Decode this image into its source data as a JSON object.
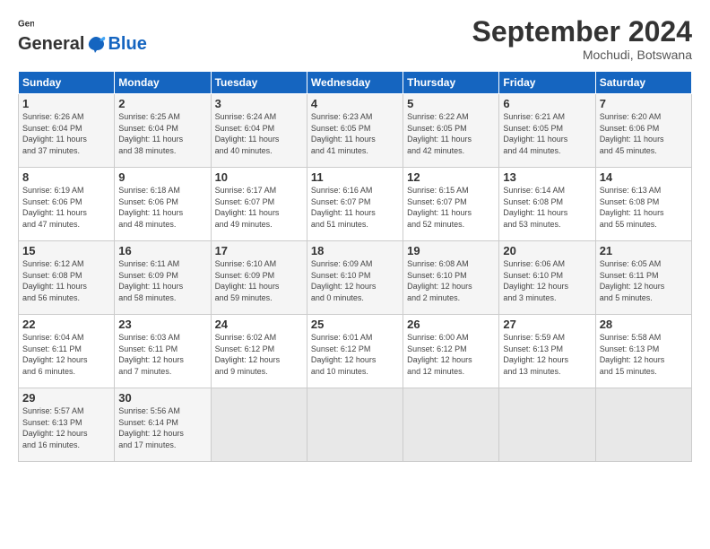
{
  "header": {
    "logo_general": "General",
    "logo_blue": "Blue",
    "month_title": "September 2024",
    "location": "Mochudi, Botswana"
  },
  "weekdays": [
    "Sunday",
    "Monday",
    "Tuesday",
    "Wednesday",
    "Thursday",
    "Friday",
    "Saturday"
  ],
  "weeks": [
    [
      {
        "day": "1",
        "info": "Sunrise: 6:26 AM\nSunset: 6:04 PM\nDaylight: 11 hours\nand 37 minutes."
      },
      {
        "day": "2",
        "info": "Sunrise: 6:25 AM\nSunset: 6:04 PM\nDaylight: 11 hours\nand 38 minutes."
      },
      {
        "day": "3",
        "info": "Sunrise: 6:24 AM\nSunset: 6:04 PM\nDaylight: 11 hours\nand 40 minutes."
      },
      {
        "day": "4",
        "info": "Sunrise: 6:23 AM\nSunset: 6:05 PM\nDaylight: 11 hours\nand 41 minutes."
      },
      {
        "day": "5",
        "info": "Sunrise: 6:22 AM\nSunset: 6:05 PM\nDaylight: 11 hours\nand 42 minutes."
      },
      {
        "day": "6",
        "info": "Sunrise: 6:21 AM\nSunset: 6:05 PM\nDaylight: 11 hours\nand 44 minutes."
      },
      {
        "day": "7",
        "info": "Sunrise: 6:20 AM\nSunset: 6:06 PM\nDaylight: 11 hours\nand 45 minutes."
      }
    ],
    [
      {
        "day": "8",
        "info": "Sunrise: 6:19 AM\nSunset: 6:06 PM\nDaylight: 11 hours\nand 47 minutes."
      },
      {
        "day": "9",
        "info": "Sunrise: 6:18 AM\nSunset: 6:06 PM\nDaylight: 11 hours\nand 48 minutes."
      },
      {
        "day": "10",
        "info": "Sunrise: 6:17 AM\nSunset: 6:07 PM\nDaylight: 11 hours\nand 49 minutes."
      },
      {
        "day": "11",
        "info": "Sunrise: 6:16 AM\nSunset: 6:07 PM\nDaylight: 11 hours\nand 51 minutes."
      },
      {
        "day": "12",
        "info": "Sunrise: 6:15 AM\nSunset: 6:07 PM\nDaylight: 11 hours\nand 52 minutes."
      },
      {
        "day": "13",
        "info": "Sunrise: 6:14 AM\nSunset: 6:08 PM\nDaylight: 11 hours\nand 53 minutes."
      },
      {
        "day": "14",
        "info": "Sunrise: 6:13 AM\nSunset: 6:08 PM\nDaylight: 11 hours\nand 55 minutes."
      }
    ],
    [
      {
        "day": "15",
        "info": "Sunrise: 6:12 AM\nSunset: 6:08 PM\nDaylight: 11 hours\nand 56 minutes."
      },
      {
        "day": "16",
        "info": "Sunrise: 6:11 AM\nSunset: 6:09 PM\nDaylight: 11 hours\nand 58 minutes."
      },
      {
        "day": "17",
        "info": "Sunrise: 6:10 AM\nSunset: 6:09 PM\nDaylight: 11 hours\nand 59 minutes."
      },
      {
        "day": "18",
        "info": "Sunrise: 6:09 AM\nSunset: 6:10 PM\nDaylight: 12 hours\nand 0 minutes."
      },
      {
        "day": "19",
        "info": "Sunrise: 6:08 AM\nSunset: 6:10 PM\nDaylight: 12 hours\nand 2 minutes."
      },
      {
        "day": "20",
        "info": "Sunrise: 6:06 AM\nSunset: 6:10 PM\nDaylight: 12 hours\nand 3 minutes."
      },
      {
        "day": "21",
        "info": "Sunrise: 6:05 AM\nSunset: 6:11 PM\nDaylight: 12 hours\nand 5 minutes."
      }
    ],
    [
      {
        "day": "22",
        "info": "Sunrise: 6:04 AM\nSunset: 6:11 PM\nDaylight: 12 hours\nand 6 minutes."
      },
      {
        "day": "23",
        "info": "Sunrise: 6:03 AM\nSunset: 6:11 PM\nDaylight: 12 hours\nand 7 minutes."
      },
      {
        "day": "24",
        "info": "Sunrise: 6:02 AM\nSunset: 6:12 PM\nDaylight: 12 hours\nand 9 minutes."
      },
      {
        "day": "25",
        "info": "Sunrise: 6:01 AM\nSunset: 6:12 PM\nDaylight: 12 hours\nand 10 minutes."
      },
      {
        "day": "26",
        "info": "Sunrise: 6:00 AM\nSunset: 6:12 PM\nDaylight: 12 hours\nand 12 minutes."
      },
      {
        "day": "27",
        "info": "Sunrise: 5:59 AM\nSunset: 6:13 PM\nDaylight: 12 hours\nand 13 minutes."
      },
      {
        "day": "28",
        "info": "Sunrise: 5:58 AM\nSunset: 6:13 PM\nDaylight: 12 hours\nand 15 minutes."
      }
    ],
    [
      {
        "day": "29",
        "info": "Sunrise: 5:57 AM\nSunset: 6:13 PM\nDaylight: 12 hours\nand 16 minutes."
      },
      {
        "day": "30",
        "info": "Sunrise: 5:56 AM\nSunset: 6:14 PM\nDaylight: 12 hours\nand 17 minutes."
      },
      {
        "day": "",
        "info": ""
      },
      {
        "day": "",
        "info": ""
      },
      {
        "day": "",
        "info": ""
      },
      {
        "day": "",
        "info": ""
      },
      {
        "day": "",
        "info": ""
      }
    ]
  ]
}
